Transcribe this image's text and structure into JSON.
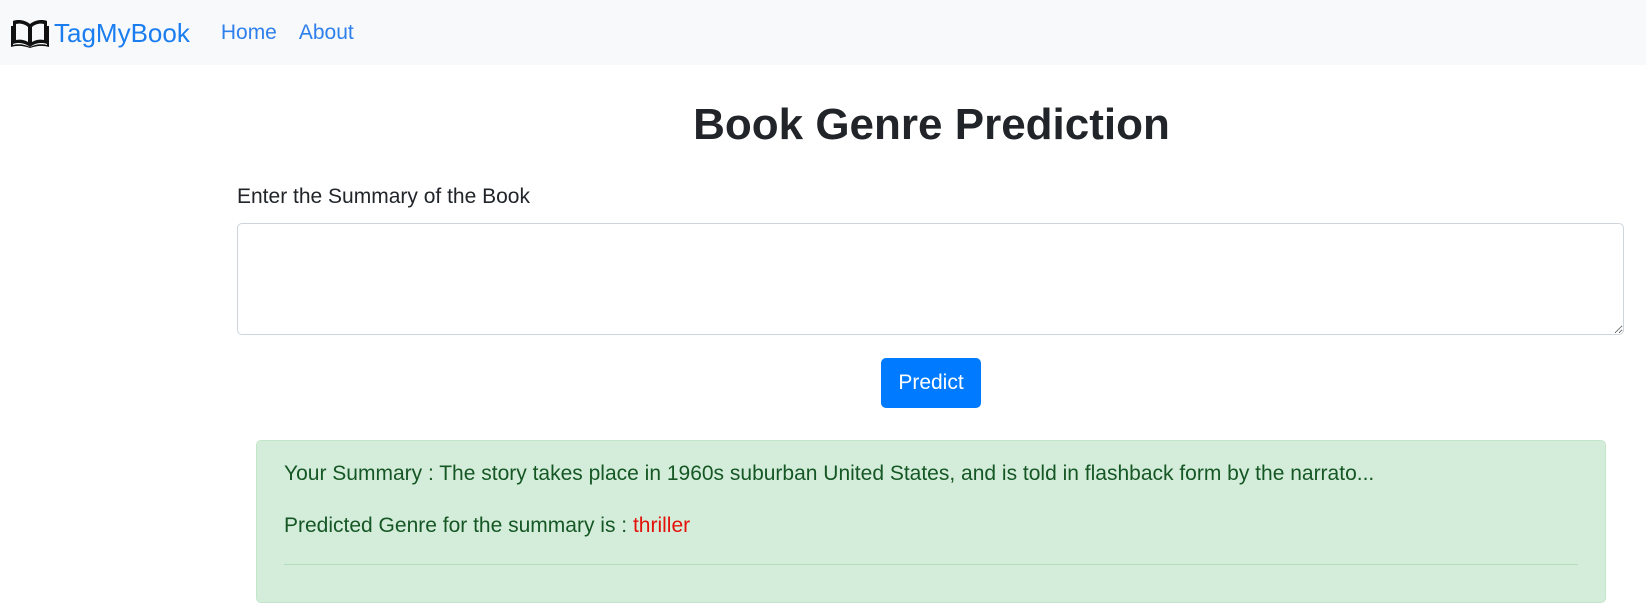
{
  "navbar": {
    "brand_icon": "open-book-icon",
    "brand_label": "TagMyBook",
    "links": [
      {
        "label": "Home"
      },
      {
        "label": "About"
      }
    ]
  },
  "main": {
    "title": "Book Genre Prediction",
    "summary_label": "Enter the Summary of the Book",
    "summary_value": "",
    "predict_label": "Predict"
  },
  "result": {
    "summary_prefix": "Your Summary : ",
    "summary_text": "The story takes place in 1960s suburban United States, and is told in flashback form by the narrato...",
    "genre_prefix": "Predicted Genre for the summary is : ",
    "genre_value": "thriller"
  },
  "colors": {
    "brand": "#1a7df0",
    "primary_button": "#007bff",
    "alert_background": "#d4edda",
    "alert_text": "#155724",
    "genre_highlight": "#e3120b"
  }
}
